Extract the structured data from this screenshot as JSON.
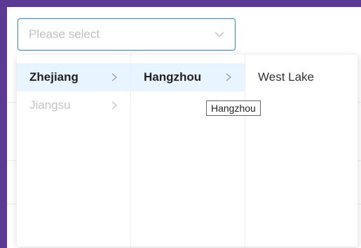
{
  "select": {
    "placeholder": "Please select"
  },
  "cascader": {
    "level1": [
      {
        "label": "Zhejiang",
        "state": "active"
      },
      {
        "label": "Jiangsu",
        "state": "disabled"
      }
    ],
    "level2": [
      {
        "label": "Hangzhou",
        "state": "active"
      }
    ],
    "level3": [
      {
        "label": "West Lake",
        "state": "normal"
      }
    ]
  },
  "tooltip": {
    "text": "Hangzhou"
  },
  "colors": {
    "accent": "#3d8fd9",
    "active_bg": "#e8f4ff",
    "disabled": "#c4c4c4"
  }
}
